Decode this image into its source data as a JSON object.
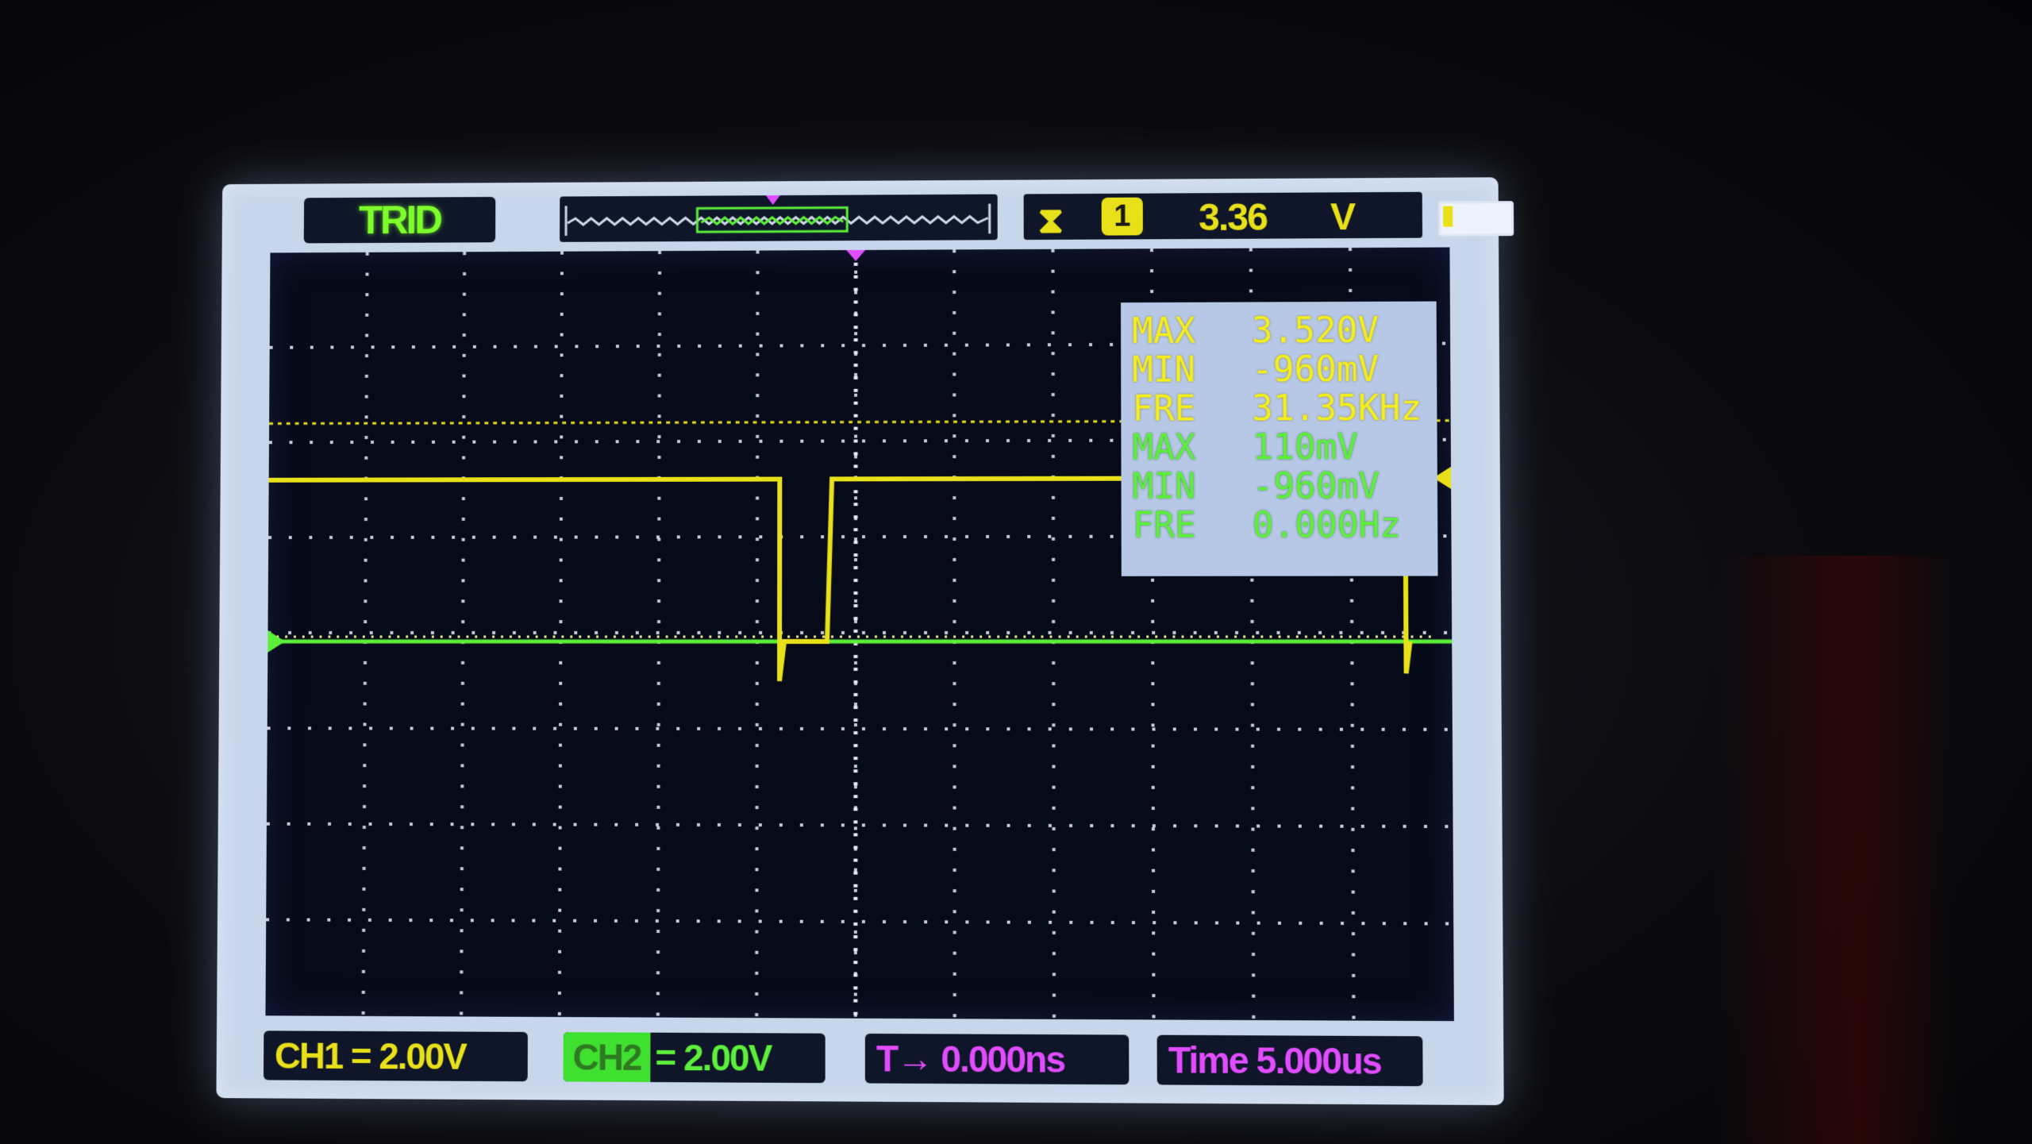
{
  "scope": {
    "mode": "TRID",
    "trigger": {
      "channel": "1",
      "level": "3.36",
      "unit": "V"
    },
    "battery_level": 0.15
  },
  "measurements": {
    "ch1": [
      {
        "label": "MAX",
        "value": "3.520V"
      },
      {
        "label": "MIN",
        "value": "-960mV"
      },
      {
        "label": "FRE",
        "value": "31.35KHz"
      }
    ],
    "ch2": [
      {
        "label": "MAX",
        "value": "110mV"
      },
      {
        "label": "MIN",
        "value": "-960mV"
      },
      {
        "label": "FRE",
        "value": "0.000Hz"
      }
    ]
  },
  "status": {
    "ch1": "CH1 = 2.00V",
    "ch2_badge": "CH2",
    "ch2_scale": "= 2.00V",
    "trigger_pos": "T→ 0.000ns",
    "timebase": "Time 5.000us"
  },
  "colors": {
    "ch1": "#e8e018",
    "ch2": "#5cf03a",
    "time": "#e24cff",
    "grid": "#e6ecf8"
  }
}
